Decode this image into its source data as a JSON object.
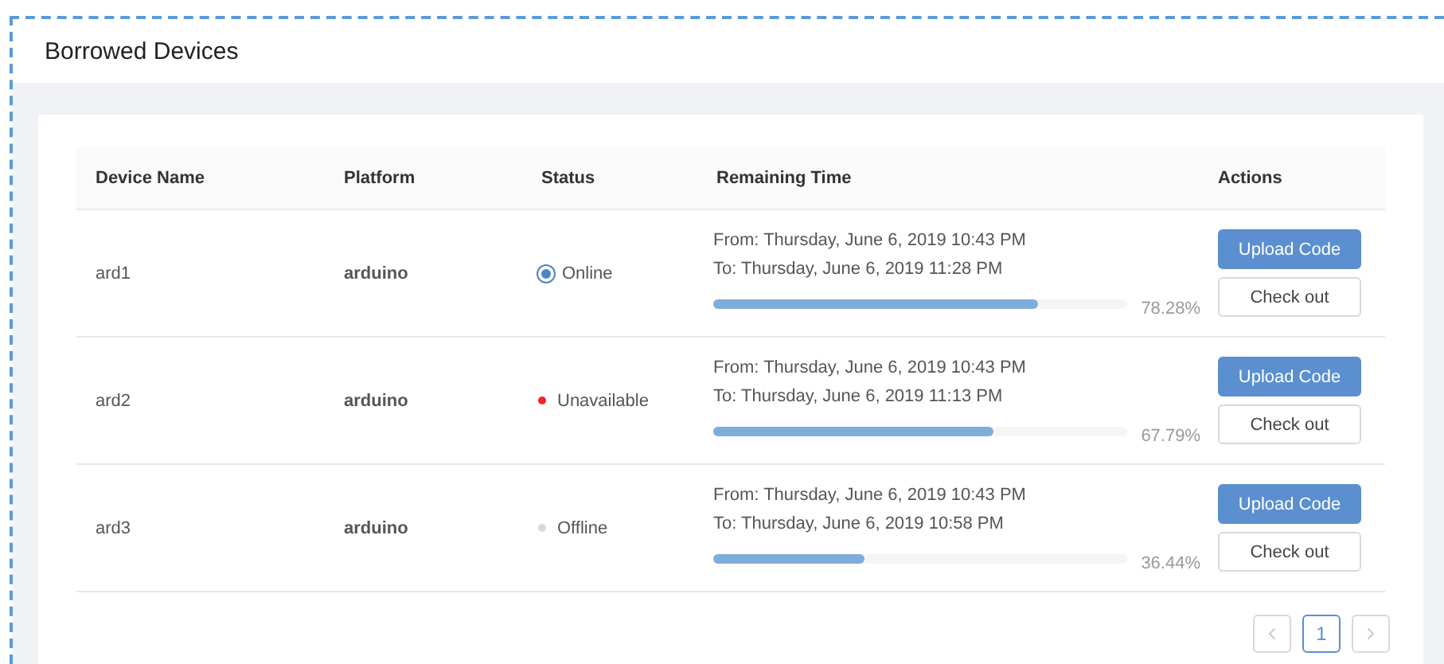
{
  "page": {
    "title": "Borrowed Devices"
  },
  "table": {
    "columns": [
      "Device Name",
      "Platform",
      "Status",
      "Remaining Time",
      "Actions"
    ],
    "rows": [
      {
        "device": "ard1",
        "platform": "arduino",
        "status": {
          "label": "Online",
          "kind": "processing",
          "color": "#4a86c8"
        },
        "from": "From: Thursday, June 6, 2019 10:43 PM",
        "to": "To: Thursday, June 6, 2019 11:28 PM",
        "level": 0.7828,
        "percent": "78.28%",
        "actions": [
          "Upload Code",
          "Check out"
        ]
      },
      {
        "device": "ard2",
        "platform": "arduino",
        "status": {
          "label": "Unavailable",
          "kind": "dot",
          "color": "#f5222d"
        },
        "from": "From: Thursday, June 6, 2019 10:43 PM",
        "to": "To: Thursday, June 6, 2019 11:13 PM",
        "level": 0.6779,
        "percent": "67.79%",
        "actions": [
          "Upload Code",
          "Check out"
        ]
      },
      {
        "device": "ard3",
        "platform": "arduino",
        "status": {
          "label": "Offline",
          "kind": "dot",
          "color": "#d9d9d9"
        },
        "from": "From: Thursday, June 6, 2019 10:43 PM",
        "to": "To: Thursday, June 6, 2019 10:58 PM",
        "level": 0.3644,
        "percent": "36.44%",
        "actions": [
          "Upload Code",
          "Check out"
        ]
      }
    ]
  },
  "pagination": {
    "prev_disabled": true,
    "next_disabled": true,
    "pages": [
      {
        "label": "1",
        "selected": true
      }
    ]
  }
}
